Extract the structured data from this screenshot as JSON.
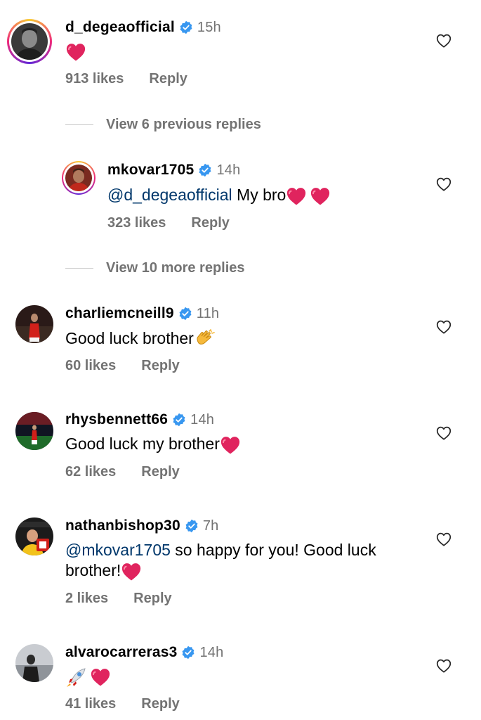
{
  "comments": [
    {
      "username": "d_degeaofficial",
      "time": "15h",
      "likes": "913 likes",
      "reply": "Reply"
    },
    {
      "username": "mkovar1705",
      "time": "14h",
      "mention": "@d_degeaofficial",
      "text": " My bro",
      "likes": "323 likes",
      "reply": "Reply"
    },
    {
      "username": "charliemcneill9",
      "time": "11h",
      "text": "Good luck brother",
      "likes": "60 likes",
      "reply": "Reply"
    },
    {
      "username": "rhysbennett66",
      "time": "14h",
      "text": "Good luck my brother",
      "likes": "62 likes",
      "reply": "Reply"
    },
    {
      "username": "nathanbishop30",
      "time": "7h",
      "mention": "@mkovar1705",
      "text": " so happy for you! Good luck",
      "text2": "brother!",
      "likes": "2 likes",
      "reply": "Reply"
    },
    {
      "username": "alvarocarreras3",
      "time": "14h",
      "likes": "41 likes",
      "reply": "Reply"
    }
  ],
  "threads": {
    "previous": "View 6 previous replies",
    "more": "View 10 more replies"
  },
  "colors": {
    "verified": "#3897f0",
    "mention": "#00376b",
    "meta": "#737373",
    "heart": "#e0245e"
  }
}
